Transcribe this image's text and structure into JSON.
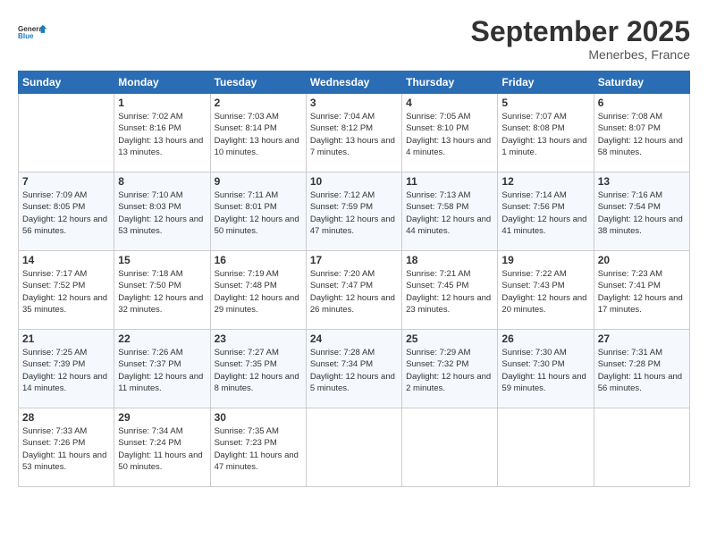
{
  "header": {
    "logo_line1": "General",
    "logo_line2": "Blue",
    "month_title": "September 2025",
    "location": "Menerbes, France"
  },
  "weekdays": [
    "Sunday",
    "Monday",
    "Tuesday",
    "Wednesday",
    "Thursday",
    "Friday",
    "Saturday"
  ],
  "weeks": [
    [
      {
        "day": "",
        "sunrise": "",
        "sunset": "",
        "daylight": ""
      },
      {
        "day": "1",
        "sunrise": "7:02 AM",
        "sunset": "8:16 PM",
        "daylight": "13 hours and 13 minutes."
      },
      {
        "day": "2",
        "sunrise": "7:03 AM",
        "sunset": "8:14 PM",
        "daylight": "13 hours and 10 minutes."
      },
      {
        "day": "3",
        "sunrise": "7:04 AM",
        "sunset": "8:12 PM",
        "daylight": "13 hours and 7 minutes."
      },
      {
        "day": "4",
        "sunrise": "7:05 AM",
        "sunset": "8:10 PM",
        "daylight": "13 hours and 4 minutes."
      },
      {
        "day": "5",
        "sunrise": "7:07 AM",
        "sunset": "8:08 PM",
        "daylight": "13 hours and 1 minute."
      },
      {
        "day": "6",
        "sunrise": "7:08 AM",
        "sunset": "8:07 PM",
        "daylight": "12 hours and 58 minutes."
      }
    ],
    [
      {
        "day": "7",
        "sunrise": "7:09 AM",
        "sunset": "8:05 PM",
        "daylight": "12 hours and 56 minutes."
      },
      {
        "day": "8",
        "sunrise": "7:10 AM",
        "sunset": "8:03 PM",
        "daylight": "12 hours and 53 minutes."
      },
      {
        "day": "9",
        "sunrise": "7:11 AM",
        "sunset": "8:01 PM",
        "daylight": "12 hours and 50 minutes."
      },
      {
        "day": "10",
        "sunrise": "7:12 AM",
        "sunset": "7:59 PM",
        "daylight": "12 hours and 47 minutes."
      },
      {
        "day": "11",
        "sunrise": "7:13 AM",
        "sunset": "7:58 PM",
        "daylight": "12 hours and 44 minutes."
      },
      {
        "day": "12",
        "sunrise": "7:14 AM",
        "sunset": "7:56 PM",
        "daylight": "12 hours and 41 minutes."
      },
      {
        "day": "13",
        "sunrise": "7:16 AM",
        "sunset": "7:54 PM",
        "daylight": "12 hours and 38 minutes."
      }
    ],
    [
      {
        "day": "14",
        "sunrise": "7:17 AM",
        "sunset": "7:52 PM",
        "daylight": "12 hours and 35 minutes."
      },
      {
        "day": "15",
        "sunrise": "7:18 AM",
        "sunset": "7:50 PM",
        "daylight": "12 hours and 32 minutes."
      },
      {
        "day": "16",
        "sunrise": "7:19 AM",
        "sunset": "7:48 PM",
        "daylight": "12 hours and 29 minutes."
      },
      {
        "day": "17",
        "sunrise": "7:20 AM",
        "sunset": "7:47 PM",
        "daylight": "12 hours and 26 minutes."
      },
      {
        "day": "18",
        "sunrise": "7:21 AM",
        "sunset": "7:45 PM",
        "daylight": "12 hours and 23 minutes."
      },
      {
        "day": "19",
        "sunrise": "7:22 AM",
        "sunset": "7:43 PM",
        "daylight": "12 hours and 20 minutes."
      },
      {
        "day": "20",
        "sunrise": "7:23 AM",
        "sunset": "7:41 PM",
        "daylight": "12 hours and 17 minutes."
      }
    ],
    [
      {
        "day": "21",
        "sunrise": "7:25 AM",
        "sunset": "7:39 PM",
        "daylight": "12 hours and 14 minutes."
      },
      {
        "day": "22",
        "sunrise": "7:26 AM",
        "sunset": "7:37 PM",
        "daylight": "12 hours and 11 minutes."
      },
      {
        "day": "23",
        "sunrise": "7:27 AM",
        "sunset": "7:35 PM",
        "daylight": "12 hours and 8 minutes."
      },
      {
        "day": "24",
        "sunrise": "7:28 AM",
        "sunset": "7:34 PM",
        "daylight": "12 hours and 5 minutes."
      },
      {
        "day": "25",
        "sunrise": "7:29 AM",
        "sunset": "7:32 PM",
        "daylight": "12 hours and 2 minutes."
      },
      {
        "day": "26",
        "sunrise": "7:30 AM",
        "sunset": "7:30 PM",
        "daylight": "11 hours and 59 minutes."
      },
      {
        "day": "27",
        "sunrise": "7:31 AM",
        "sunset": "7:28 PM",
        "daylight": "11 hours and 56 minutes."
      }
    ],
    [
      {
        "day": "28",
        "sunrise": "7:33 AM",
        "sunset": "7:26 PM",
        "daylight": "11 hours and 53 minutes."
      },
      {
        "day": "29",
        "sunrise": "7:34 AM",
        "sunset": "7:24 PM",
        "daylight": "11 hours and 50 minutes."
      },
      {
        "day": "30",
        "sunrise": "7:35 AM",
        "sunset": "7:23 PM",
        "daylight": "11 hours and 47 minutes."
      },
      {
        "day": "",
        "sunrise": "",
        "sunset": "",
        "daylight": ""
      },
      {
        "day": "",
        "sunrise": "",
        "sunset": "",
        "daylight": ""
      },
      {
        "day": "",
        "sunrise": "",
        "sunset": "",
        "daylight": ""
      },
      {
        "day": "",
        "sunrise": "",
        "sunset": "",
        "daylight": ""
      }
    ]
  ]
}
